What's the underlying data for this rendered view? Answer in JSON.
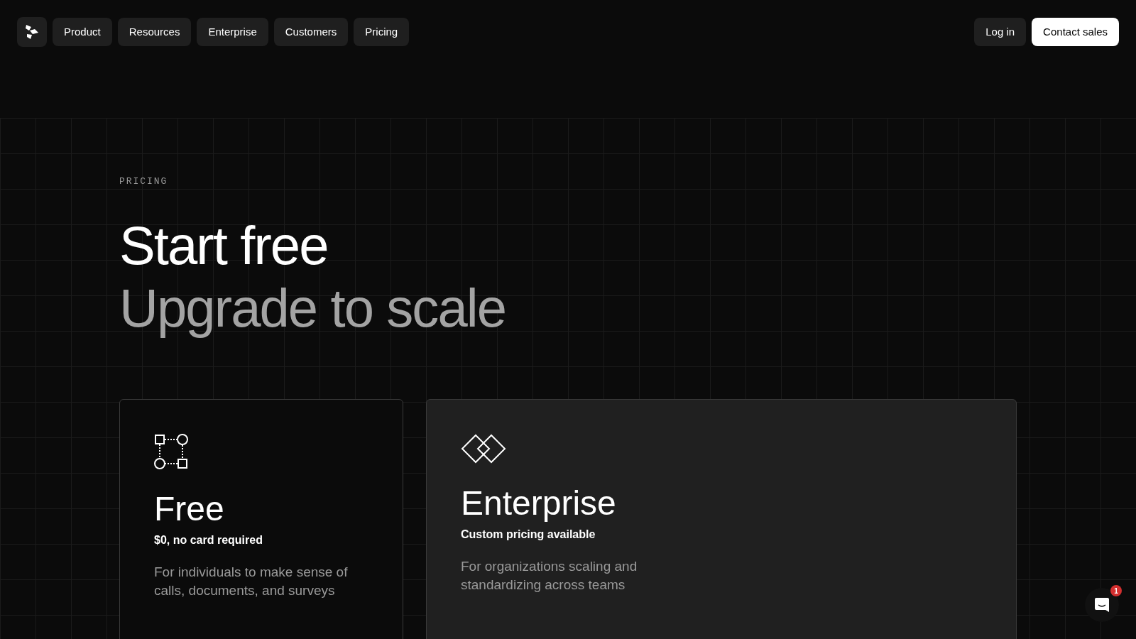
{
  "nav": {
    "items": [
      {
        "label": "Product"
      },
      {
        "label": "Resources"
      },
      {
        "label": "Enterprise"
      },
      {
        "label": "Customers"
      },
      {
        "label": "Pricing"
      }
    ],
    "actions": [
      {
        "label": "Log in",
        "kind": "secondary"
      },
      {
        "label": "Contact sales",
        "kind": "primary"
      }
    ]
  },
  "hero": {
    "eyebrow": "PRICING",
    "title": "Start free",
    "subtitle": "Upgrade to scale"
  },
  "plans": [
    {
      "kind": "free",
      "name": "Free",
      "price": "$0, no card required",
      "description": "For individuals to make sense of calls, documents, and surveys"
    },
    {
      "kind": "enterprise",
      "name": "Enterprise",
      "price": "Custom pricing available",
      "description": "For organizations scaling and standardizing across teams"
    }
  ],
  "chat": {
    "badge": "1"
  }
}
